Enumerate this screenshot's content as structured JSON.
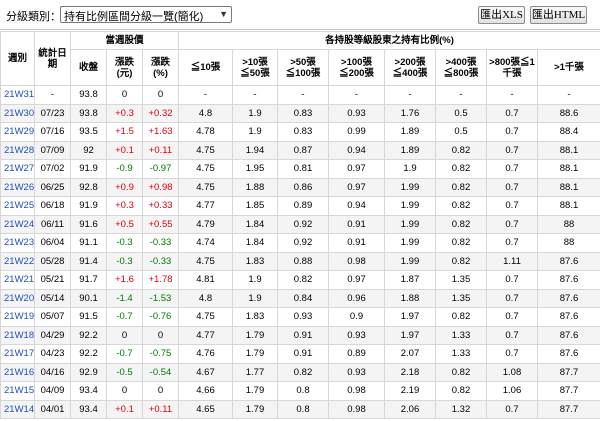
{
  "toolbar": {
    "category_label": "分級類別：",
    "category_selected": "持有比例區間分級一覽(簡化)",
    "export_xls": "匯出XLS",
    "export_html": "匯出HTML"
  },
  "table": {
    "headers": {
      "week": "週別",
      "stat_date": "統計日期",
      "price_group": "當週股價",
      "close": "收盤",
      "change": "漲跌(元)",
      "change_pct": "漲跌(%)",
      "ratio_group": "各持股等級股東之持有比例(%)",
      "levels": [
        "≦10張",
        ">10張≦50張",
        ">50張≦100張",
        ">100張≦200張",
        ">200張≦400張",
        ">400張≦800張",
        ">800張≦1千張",
        ">1千張"
      ]
    },
    "rows": [
      {
        "week": "21W31",
        "date": "-",
        "close": "93.8",
        "chg": "0",
        "pct": "0",
        "dir": "flat",
        "v": [
          "-",
          "-",
          "-",
          "-",
          "-",
          "-",
          "-",
          "-"
        ]
      },
      {
        "week": "21W30",
        "date": "07/23",
        "close": "93.8",
        "chg": "+0.3",
        "pct": "+0.32",
        "dir": "up",
        "v": [
          "4.8",
          "1.9",
          "0.83",
          "0.93",
          "1.76",
          "0.5",
          "0.7",
          "88.6"
        ]
      },
      {
        "week": "21W29",
        "date": "07/16",
        "close": "93.5",
        "chg": "+1.5",
        "pct": "+1.63",
        "dir": "up",
        "v": [
          "4.78",
          "1.9",
          "0.83",
          "0.99",
          "1.89",
          "0.5",
          "0.7",
          "88.4"
        ]
      },
      {
        "week": "21W28",
        "date": "07/09",
        "close": "92",
        "chg": "+0.1",
        "pct": "+0.11",
        "dir": "up",
        "v": [
          "4.75",
          "1.94",
          "0.87",
          "0.94",
          "1.89",
          "0.82",
          "0.7",
          "88.1"
        ]
      },
      {
        "week": "21W27",
        "date": "07/02",
        "close": "91.9",
        "chg": "-0.9",
        "pct": "-0.97",
        "dir": "down",
        "v": [
          "4.75",
          "1.95",
          "0.81",
          "0.97",
          "1.9",
          "0.82",
          "0.7",
          "88.1"
        ]
      },
      {
        "week": "21W26",
        "date": "06/25",
        "close": "92.8",
        "chg": "+0.9",
        "pct": "+0.98",
        "dir": "up",
        "v": [
          "4.75",
          "1.88",
          "0.86",
          "0.97",
          "1.99",
          "0.82",
          "0.7",
          "88.1"
        ]
      },
      {
        "week": "21W25",
        "date": "06/18",
        "close": "91.9",
        "chg": "+0.3",
        "pct": "+0.33",
        "dir": "up",
        "v": [
          "4.77",
          "1.85",
          "0.89",
          "0.94",
          "1.99",
          "0.82",
          "0.7",
          "88.1"
        ]
      },
      {
        "week": "21W24",
        "date": "06/11",
        "close": "91.6",
        "chg": "+0.5",
        "pct": "+0.55",
        "dir": "up",
        "v": [
          "4.79",
          "1.84",
          "0.92",
          "0.91",
          "1.99",
          "0.82",
          "0.7",
          "88"
        ]
      },
      {
        "week": "21W23",
        "date": "06/04",
        "close": "91.1",
        "chg": "-0.3",
        "pct": "-0.33",
        "dir": "down",
        "v": [
          "4.74",
          "1.84",
          "0.92",
          "0.91",
          "1.99",
          "0.82",
          "0.7",
          "88"
        ]
      },
      {
        "week": "21W22",
        "date": "05/28",
        "close": "91.4",
        "chg": "-0.3",
        "pct": "-0.33",
        "dir": "down",
        "v": [
          "4.75",
          "1.83",
          "0.88",
          "0.98",
          "1.99",
          "0.82",
          "1.11",
          "87.6"
        ]
      },
      {
        "week": "21W21",
        "date": "05/21",
        "close": "91.7",
        "chg": "+1.6",
        "pct": "+1.78",
        "dir": "up",
        "v": [
          "4.81",
          "1.9",
          "0.82",
          "0.97",
          "1.87",
          "1.35",
          "0.7",
          "87.6"
        ]
      },
      {
        "week": "21W20",
        "date": "05/14",
        "close": "90.1",
        "chg": "-1.4",
        "pct": "-1.53",
        "dir": "down",
        "v": [
          "4.8",
          "1.9",
          "0.84",
          "0.96",
          "1.88",
          "1.35",
          "0.7",
          "87.6"
        ]
      },
      {
        "week": "21W19",
        "date": "05/07",
        "close": "91.5",
        "chg": "-0.7",
        "pct": "-0.76",
        "dir": "down",
        "v": [
          "4.75",
          "1.83",
          "0.93",
          "0.9",
          "1.97",
          "0.82",
          "0.7",
          "87.6"
        ]
      },
      {
        "week": "21W18",
        "date": "04/29",
        "close": "92.2",
        "chg": "0",
        "pct": "0",
        "dir": "flat",
        "v": [
          "4.77",
          "1.79",
          "0.91",
          "0.93",
          "1.97",
          "1.33",
          "0.7",
          "87.6"
        ]
      },
      {
        "week": "21W17",
        "date": "04/23",
        "close": "92.2",
        "chg": "-0.7",
        "pct": "-0.75",
        "dir": "down",
        "v": [
          "4.76",
          "1.79",
          "0.91",
          "0.89",
          "2.07",
          "1.33",
          "0.7",
          "87.6"
        ]
      },
      {
        "week": "21W16",
        "date": "04/16",
        "close": "92.9",
        "chg": "-0.5",
        "pct": "-0.54",
        "dir": "down",
        "v": [
          "4.67",
          "1.77",
          "0.82",
          "0.93",
          "2.18",
          "0.82",
          "1.08",
          "87.7"
        ]
      },
      {
        "week": "21W15",
        "date": "04/09",
        "close": "93.4",
        "chg": "0",
        "pct": "0",
        "dir": "flat",
        "v": [
          "4.66",
          "1.79",
          "0.8",
          "0.98",
          "2.19",
          "0.82",
          "1.06",
          "87.7"
        ]
      },
      {
        "week": "21W14",
        "date": "04/01",
        "close": "93.4",
        "chg": "+0.1",
        "pct": "+0.11",
        "dir": "up",
        "v": [
          "4.65",
          "1.79",
          "0.8",
          "0.98",
          "2.06",
          "1.32",
          "0.7",
          "87.7"
        ]
      }
    ]
  },
  "colors": {
    "up": "#e0000f",
    "down": "#007a00",
    "week_link": "#1f4fbf"
  }
}
